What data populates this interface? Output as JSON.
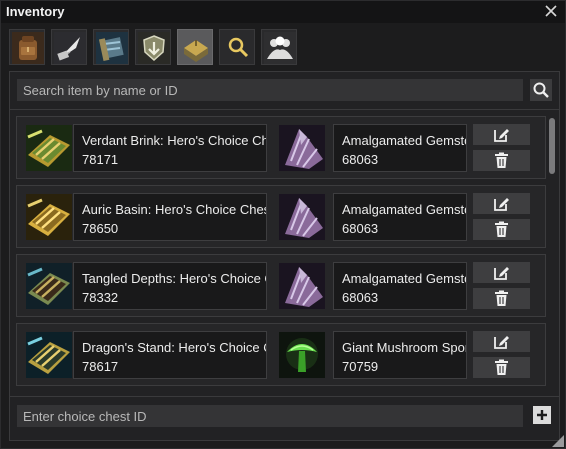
{
  "window": {
    "title": "Inventory"
  },
  "tabs": [
    {
      "icon": "backpack-icon"
    },
    {
      "icon": "feather-quill-icon"
    },
    {
      "icon": "map-scroll-icon"
    },
    {
      "icon": "shield-chest-icon"
    },
    {
      "icon": "choice-chest-icon",
      "active": true
    },
    {
      "icon": "magnifier-icon"
    },
    {
      "icon": "group-icon"
    }
  ],
  "search": {
    "placeholder": "Search item by name or ID",
    "value": ""
  },
  "entries": [
    {
      "chest_name": "Verdant Brink: Hero's Choice Chest",
      "chest_id": "78171",
      "item_name": "Amalgamated Gemstone",
      "item_id": "68063"
    },
    {
      "chest_name": "Auric Basin: Hero's Choice Chest",
      "chest_id": "78650",
      "item_name": "Amalgamated Gemstone",
      "item_id": "68063"
    },
    {
      "chest_name": "Tangled Depths: Hero's Choice Chest",
      "chest_id": "78332",
      "item_name": "Amalgamated Gemstone",
      "item_id": "68063"
    },
    {
      "chest_name": "Dragon's Stand: Hero's Choice Chest",
      "chest_id": "78617",
      "item_name": "Giant Mushroom Spore",
      "item_id": "70759"
    }
  ],
  "chest_input": {
    "placeholder": "Enter choice chest ID",
    "value": ""
  },
  "colors": {
    "background": "#1c1c1d",
    "panel": "#222224",
    "button": "#3e3e40",
    "text": "#ececec"
  }
}
